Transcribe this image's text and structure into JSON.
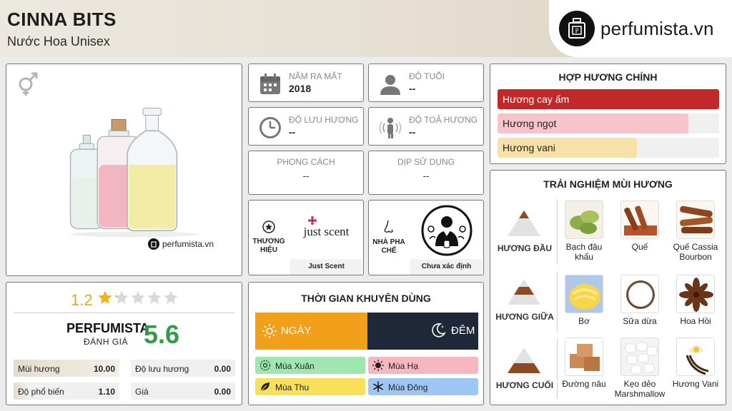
{
  "header": {
    "title": "CINNA BITS",
    "subtitle": "Nước Hoa Unisex",
    "logo_text": "perfumista.vn"
  },
  "product": {
    "watermark": "perfumista.vn",
    "gender_icon": "unisex-icon"
  },
  "info": {
    "launch_label": "Năm ra mắt",
    "launch_value": "2018",
    "age_label": "Độ tuổi",
    "age_value": "--",
    "longevity_label": "Độ lưu hương",
    "longevity_value": "--",
    "sillage_label": "Độ toả hương",
    "sillage_value": "--",
    "style_label": "Phong cách",
    "style_value": "--",
    "occasion_label": "Dịp sử dụng",
    "occasion_value": "--"
  },
  "brand": {
    "label_line1": "THƯƠNG",
    "label_line2": "HIỆU",
    "logo_text": "just scent",
    "name": "Just Scent"
  },
  "perfumer": {
    "label_line1": "NHÀ PHA",
    "label_line2": "CHẾ",
    "name": "Chưa xác định"
  },
  "accords": {
    "title": "HỢP HƯƠNG CHÍNH",
    "items": [
      {
        "label": "Hương cay ấm",
        "percent": 100,
        "color": "#c0282a",
        "text_color": "#ffffff"
      },
      {
        "label": "Hương ngọt",
        "percent": 86,
        "color": "#f8c4cc",
        "text_color": "#222222"
      },
      {
        "label": "Hương vani",
        "percent": 63,
        "color": "#f6e1a8",
        "text_color": "#222222"
      }
    ]
  },
  "notes": {
    "title": "TRẢI NGHIỆM MÙI HƯƠNG",
    "top_label": "HƯƠNG ĐẦU",
    "middle_label": "HƯƠNG GIỮA",
    "base_label": "HƯƠNG CUỐI",
    "top": [
      "Bạch đậu khấu",
      "Quế",
      "Quế Cassia Bourbon"
    ],
    "middle": [
      "Bơ",
      "Sữa dừa",
      "Hoa Hồi"
    ],
    "base": [
      "Đường nâu",
      "Kẹo dẻo Marshmallow",
      "Hương Vani"
    ]
  },
  "rating": {
    "value": "1.2",
    "stars_filled": 1.2,
    "stars_total": 5,
    "pf_name": "PERFUMISTA",
    "pf_sub": "ĐÁNH GIÁ",
    "pf_score": "5.6",
    "stats": [
      {
        "label": "Mùi hương",
        "value": "10.00"
      },
      {
        "label": "Độ lưu hương",
        "value": "0.00"
      },
      {
        "label": "Độ phổ biến",
        "value": "1.10"
      },
      {
        "label": "Giá",
        "value": "0.00"
      }
    ]
  },
  "time": {
    "title": "THỜI GIAN KHUYÊN DÙNG",
    "day": "NGÀY",
    "night": "ĐÊM",
    "seasons": [
      {
        "label": "Mùa Xuân",
        "color": "#9fe6b1"
      },
      {
        "label": "Mùa Hạ",
        "color": "#f6b7c0"
      },
      {
        "label": "Mùa Thu",
        "color": "#f8e05b"
      },
      {
        "label": "Mùa Đông",
        "color": "#9dc6f5"
      }
    ]
  }
}
